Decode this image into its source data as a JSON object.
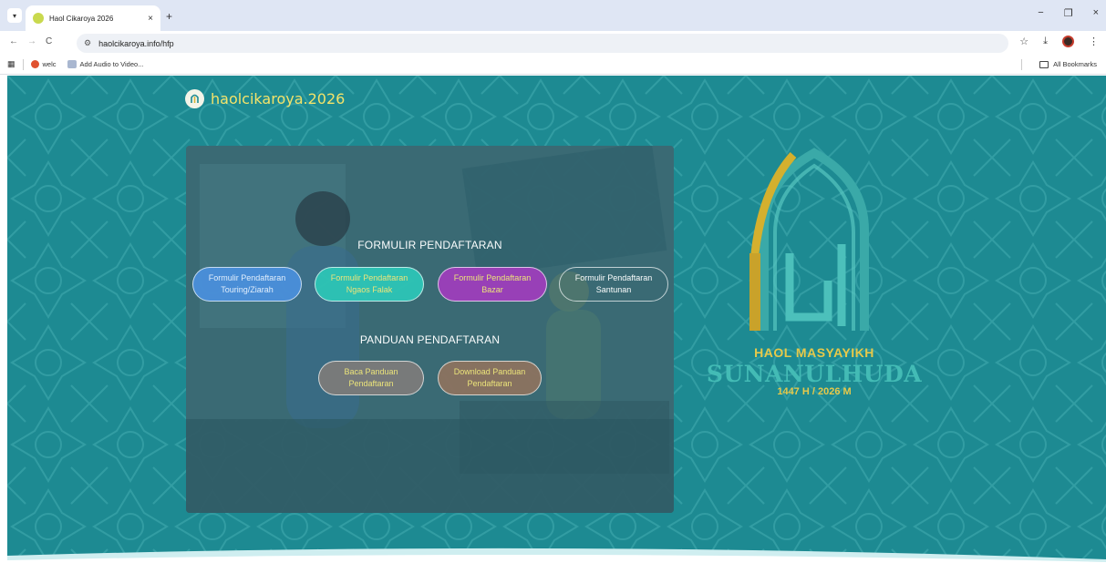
{
  "browser": {
    "tab_title": "Haol Cikaroya 2026",
    "tab_close": "×",
    "new_tab": "+",
    "url": "haolcikaroya.info/hfp",
    "minimize": "−",
    "restore": "❐",
    "close": "×",
    "back": "←",
    "forward": "→",
    "reload": "C",
    "star": "☆",
    "download": "⤓",
    "more": "⋮",
    "bookmarks": [
      "welc",
      "Add Audio to Video..."
    ],
    "all_bookmarks": "All Bookmarks"
  },
  "page": {
    "brand": "haolcikaroya.2026",
    "form_section_title": "FORMULIR PENDAFTARAN",
    "form_buttons": [
      {
        "line1": "Formulir Pendaftaran",
        "line2": "Touring/Ziarah",
        "color": "#4a8ed8",
        "text_color": "#e5f0ff"
      },
      {
        "line1": "Formulir Pendaftaran",
        "line2": "Ngaos Falak",
        "color": "#2ec2b4",
        "text_color": "#f0e67a"
      },
      {
        "line1": "Formulir Pendaftaran",
        "line2": "Bazar",
        "color": "#9b3fb8",
        "text_color": "#f0e67a"
      },
      {
        "line1": "Formulir Pendaftaran",
        "line2": "Santunan",
        "color": "transparent",
        "text_color": "#ffffff"
      }
    ],
    "guide_section_title": "PANDUAN PENDAFTARAN",
    "guide_buttons": [
      {
        "line1": "Baca Panduan",
        "line2": "Pendaftaran",
        "color": "#7a7a7a",
        "text_color": "#f0e67a"
      },
      {
        "line1": "Download Panduan",
        "line2": "Pendaftaran",
        "color": "#8a7260",
        "text_color": "#f0e67a"
      }
    ],
    "logo_title": "HAOL MASYAYIKH",
    "logo_name": "SUNANULHUDA",
    "logo_year": "1447 H / 2026 M",
    "colors": {
      "background": "#1d8a92",
      "accent_gold": "#e7c94a",
      "accent_teal": "#43bbb5"
    }
  }
}
